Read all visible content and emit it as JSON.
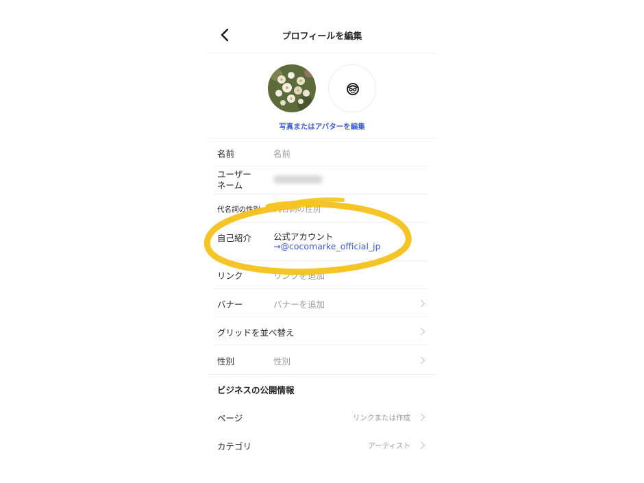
{
  "header": {
    "title": "プロフィールを編集"
  },
  "avatar": {
    "edit_label": "写真またはアバターを編集"
  },
  "fields": {
    "name": {
      "label": "名前",
      "placeholder": "名前"
    },
    "username": {
      "label_line1": "ユーザー",
      "label_line2": "ネーム"
    },
    "pronouns": {
      "label": "代名詞の性別",
      "placeholder": "代名詞の性別"
    },
    "bio": {
      "label": "自己紹介",
      "line1": "公式アカウント",
      "line2": "→@cocomarke_official_jp"
    },
    "links": {
      "label": "リンク",
      "placeholder": "リンクを追加"
    },
    "banner": {
      "label": "バナー",
      "placeholder": "バナーを追加"
    },
    "grid": {
      "label": "グリッドを並べ替え"
    },
    "gender": {
      "label": "性別",
      "placeholder": "性別"
    }
  },
  "business": {
    "section_title": "ビジネスの公開情報",
    "page": {
      "label": "ページ",
      "value": "リンクまたは作成"
    },
    "category": {
      "label": "カテゴリ",
      "value": "アーティスト"
    }
  },
  "colors": {
    "accent": "#3f5fcf",
    "highlight": "#f4c21c"
  },
  "icons": [
    "back-arrow-icon",
    "avatar-sticker-icon",
    "chevron-right-icon"
  ]
}
